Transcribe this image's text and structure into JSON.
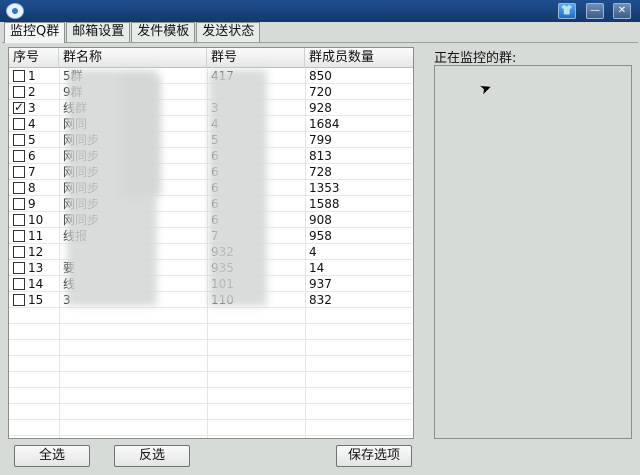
{
  "window": {
    "icon": "eye-icon",
    "controls": [
      "skin-icon",
      "minimize-icon",
      "close-icon"
    ]
  },
  "tabs": [
    {
      "label": "监控Q群",
      "active": true
    },
    {
      "label": "邮箱设置",
      "active": false
    },
    {
      "label": "发件模板",
      "active": false
    },
    {
      "label": "发送状态",
      "active": false
    }
  ],
  "table": {
    "headers": [
      "序号",
      "群名称",
      "群号",
      "群成员数量"
    ],
    "rows": [
      {
        "seq": "1",
        "checked": false,
        "name": "5群",
        "num": "417",
        "count": "850"
      },
      {
        "seq": "2",
        "checked": false,
        "name": "9群",
        "num": "",
        "count": "720"
      },
      {
        "seq": "3",
        "checked": true,
        "name": "线群",
        "num": "3",
        "count": "928"
      },
      {
        "seq": "4",
        "checked": false,
        "name": "网同",
        "num": "4",
        "count": "1684"
      },
      {
        "seq": "5",
        "checked": false,
        "name": "网同步",
        "num": "5",
        "count": "799"
      },
      {
        "seq": "6",
        "checked": false,
        "name": "网同步",
        "num": "6",
        "count": "813"
      },
      {
        "seq": "7",
        "checked": false,
        "name": "网同步",
        "num": "6",
        "count": "728"
      },
      {
        "seq": "8",
        "checked": false,
        "name": "网同步",
        "num": "6",
        "count": "1353"
      },
      {
        "seq": "9",
        "checked": false,
        "name": "网同步",
        "num": "6",
        "count": "1588"
      },
      {
        "seq": "10",
        "checked": false,
        "name": "网同步",
        "num": "6",
        "count": "908"
      },
      {
        "seq": "11",
        "checked": false,
        "name": "线报",
        "num": "7",
        "count": "958"
      },
      {
        "seq": "12",
        "checked": false,
        "name": "",
        "num": "932",
        "count": "4"
      },
      {
        "seq": "13",
        "checked": false,
        "name": "要",
        "num": "935",
        "count": "14"
      },
      {
        "seq": "14",
        "checked": false,
        "name": "线",
        "num": "101",
        "count": "937"
      },
      {
        "seq": "15",
        "checked": false,
        "name": "3",
        "num": "110",
        "count": "832"
      }
    ]
  },
  "monitor": {
    "label": "正在监控的群:"
  },
  "buttons": {
    "select_all": "全选",
    "invert": "反选",
    "save": "保存选项"
  }
}
